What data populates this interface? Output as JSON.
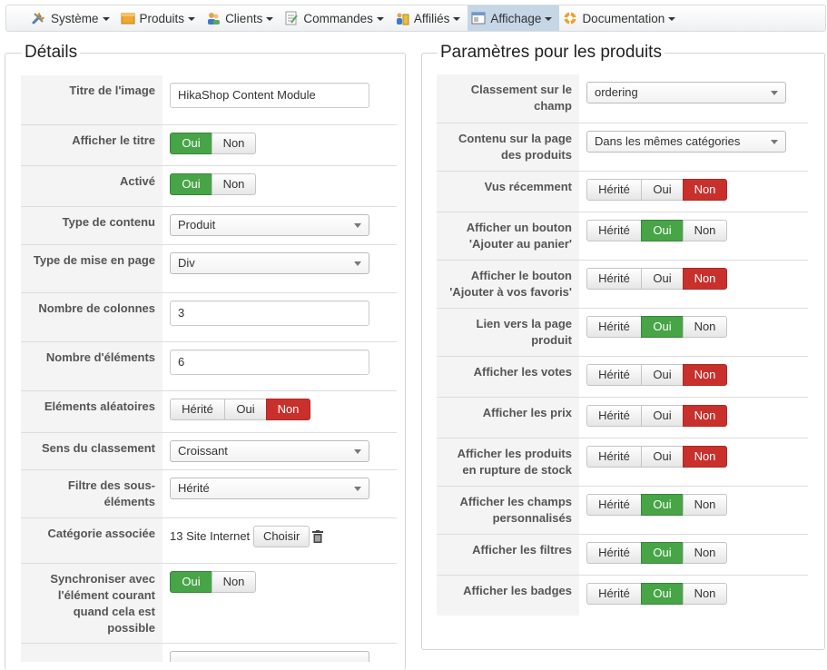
{
  "menu": [
    {
      "label": "Système",
      "icon": "tools-icon"
    },
    {
      "label": "Produits",
      "icon": "product-box-icon"
    },
    {
      "label": "Clients",
      "icon": "users-icon"
    },
    {
      "label": "Commandes",
      "icon": "orders-icon"
    },
    {
      "label": "Affiliés",
      "icon": "affiliates-icon"
    },
    {
      "label": "Affichage",
      "icon": "display-icon",
      "active": true
    },
    {
      "label": "Documentation",
      "icon": "help-lifebuoy-icon"
    }
  ],
  "left": {
    "legend": "Détails",
    "image_title": {
      "label": "Titre de l'image",
      "value": "HikaShop Content Module"
    },
    "show_title": {
      "label": "Afficher le titre",
      "oui": "Oui",
      "non": "Non"
    },
    "active": {
      "label": "Activé",
      "oui": "Oui",
      "non": "Non"
    },
    "content_type": {
      "label": "Type de contenu",
      "value": "Produit"
    },
    "layout_type": {
      "label": "Type de mise en page",
      "value": "Div"
    },
    "columns": {
      "label": "Nombre de colonnes",
      "value": "3"
    },
    "elements": {
      "label": "Nombre d'éléments",
      "value": "6"
    },
    "random": {
      "label": "Eléments aléatoires",
      "herite": "Hérité",
      "oui": "Oui",
      "non": "Non"
    },
    "order_dir": {
      "label": "Sens du classement",
      "value": "Croissant"
    },
    "sub_filter": {
      "label": "Filtre des sous-éléments",
      "value": "Hérité"
    },
    "category": {
      "label": "Catégorie associée",
      "value": "13 Site Internet",
      "button": "Choisir"
    },
    "sync": {
      "label": "Synchroniser avec l'élément courant quand cela est possible",
      "oui": "Oui",
      "non": "Non"
    }
  },
  "right": {
    "legend": "Paramètres pour les produits",
    "ordering": {
      "label": "Classement sur le champ",
      "value": "ordering"
    },
    "page_content": {
      "label": "Contenu sur la page des produits",
      "value": "Dans les mêmes catégories"
    },
    "toggles": [
      {
        "label": "Vus récemment",
        "state": "non"
      },
      {
        "label": "Afficher un bouton 'Ajouter au panier'",
        "state": "oui"
      },
      {
        "label": "Afficher le bouton 'Ajouter à vos favoris'",
        "state": "non"
      },
      {
        "label": "Lien vers la page produit",
        "state": "oui"
      },
      {
        "label": "Afficher les votes",
        "state": "non"
      },
      {
        "label": "Afficher les prix",
        "state": "non"
      },
      {
        "label": "Afficher les produits en rupture de stock",
        "state": "non"
      },
      {
        "label": "Afficher les champs personnalisés",
        "state": "oui"
      },
      {
        "label": "Afficher les filtres",
        "state": "oui"
      },
      {
        "label": "Afficher les badges",
        "state": "oui"
      }
    ],
    "btn_labels": {
      "herite": "Hérité",
      "oui": "Oui",
      "non": "Non"
    }
  },
  "colors": {
    "green": "#47a447",
    "red": "#c9302c",
    "active_menu": "#c5d6e6"
  }
}
